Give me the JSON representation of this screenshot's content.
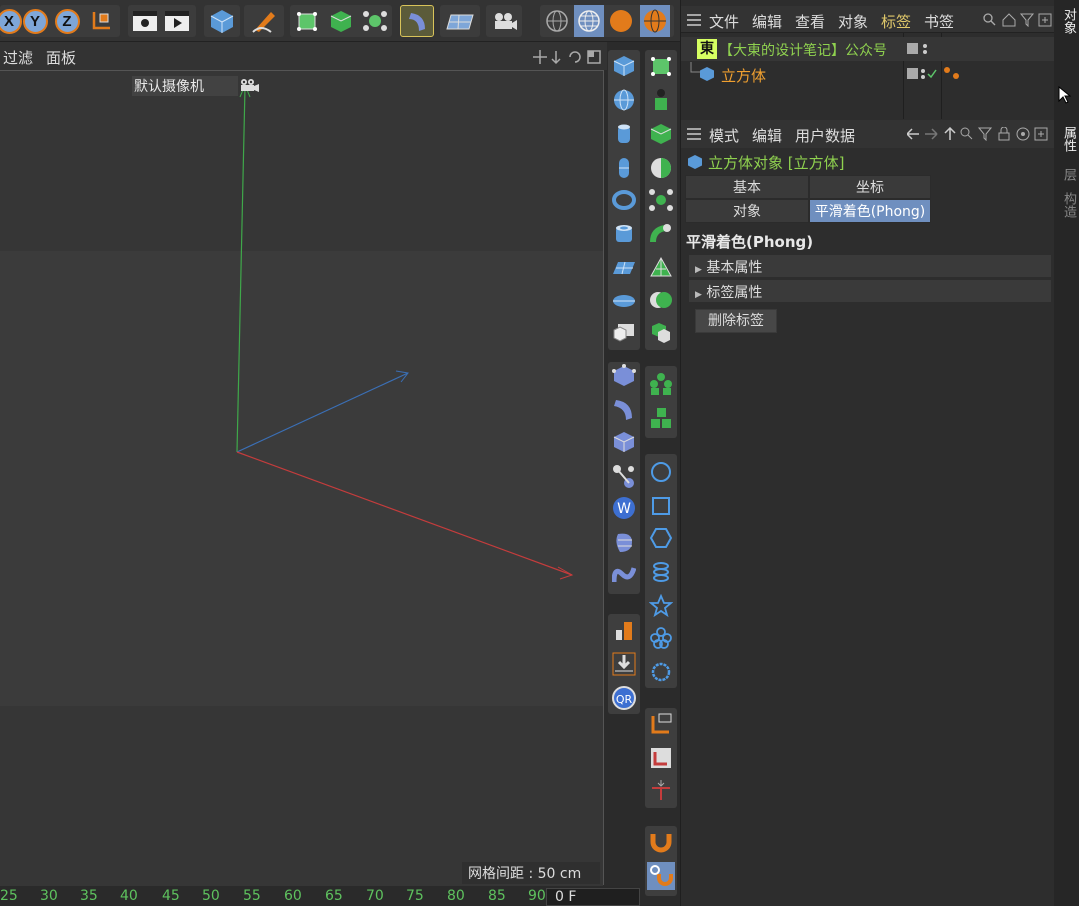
{
  "viewport": {
    "menu": [
      "过滤",
      "面板"
    ],
    "camera_label": "默认摄像机",
    "grid_spacing": "网格间距 : 50 cm"
  },
  "timeline": {
    "ticks": [
      "25",
      "30",
      "35",
      "40",
      "45",
      "50",
      "55",
      "60",
      "65",
      "70",
      "75",
      "80",
      "85",
      "90"
    ],
    "current_frame": "0 F"
  },
  "object_manager": {
    "menu": [
      "文件",
      "编辑",
      "查看",
      "对象",
      "标签",
      "书签"
    ],
    "highlighted_menu": "标签",
    "objects": [
      {
        "name": "【大東的设计笔记】公众号",
        "icon": "dong-logo-icon",
        "color": "#8fd14f"
      },
      {
        "name": "立方体",
        "icon": "cube-icon",
        "color": "#f0a030"
      }
    ],
    "logo_char": "東"
  },
  "attribute_manager": {
    "menu": [
      "模式",
      "编辑",
      "用户数据"
    ],
    "object_title": "立方体对象 [立方体]",
    "tabs": [
      "基本",
      "坐标",
      "对象",
      "平滑着色(Phong)"
    ],
    "active_tab": "平滑着色(Phong)",
    "section_title": "平滑着色(Phong)",
    "groups": [
      "基本属性",
      "标签属性"
    ],
    "delete_button": "删除标签"
  },
  "side_tabs": [
    "对象",
    "属性",
    "层",
    "构造"
  ],
  "colors": {
    "accent_blue": "#7ea6d8",
    "accent_orange": "#e27b1b",
    "axis_x": "#c43c3c",
    "axis_y": "#3fa84a",
    "axis_z": "#3b6fb5",
    "title_green": "#8fd14f"
  }
}
